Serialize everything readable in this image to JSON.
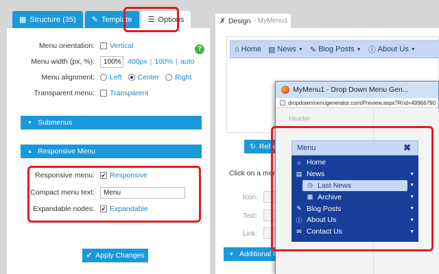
{
  "left_tabs": [
    {
      "label": "Structure (35)",
      "icon": "sitemap-icon"
    },
    {
      "label": "Template",
      "icon": "brush-icon"
    },
    {
      "label": "Options",
      "icon": "list-icon"
    }
  ],
  "options": {
    "orientation_label": "Menu orientation:",
    "orientation_value": "Vertical",
    "width_label": "Menu width (px, %):",
    "width_value": "100%",
    "width_presets": [
      "400px",
      "100%",
      "auto"
    ],
    "alignment_label": "Menu alignment:",
    "alignment_options": [
      "Left",
      "Center",
      "Right"
    ],
    "alignment_selected": "Center",
    "transparent_label": "Transparent menu:",
    "transparent_value": "Transparent",
    "help": "?"
  },
  "sections": {
    "submenus": "Submenus",
    "responsive": "Responsive Menu"
  },
  "responsive": {
    "responsive_label": "Responsive menu:",
    "responsive_value": "Responsive",
    "compact_label": "Compact menu text:",
    "compact_value": "Menu",
    "expandable_label": "Expandable nodes:",
    "expandable_value": "Expandable"
  },
  "apply_label": "Apply Changes",
  "design": {
    "title": "Design",
    "subtitle": "- MyMenu1",
    "menubar": [
      "Home",
      "News",
      "Blog Posts",
      "About Us"
    ],
    "refresh_label": "Refres",
    "click_message": "Click on a menu i",
    "props": [
      "Icon:",
      "Text:",
      "Link:"
    ],
    "additional_label": "Additional Op"
  },
  "popup": {
    "title": "MyMenu1 - Drop Down Menu Gen...",
    "url": "dropdownmenugenerator.com/Preview.aspx?Rnd=49966790",
    "header": "Header",
    "menu_title": "Menu",
    "close": "✖",
    "items": [
      {
        "label": "Home",
        "icon": "home-icon",
        "glyph": "⌂",
        "level": 0,
        "arrow": false,
        "highlight": false
      },
      {
        "label": "News",
        "icon": "newspaper-icon",
        "glyph": "▤",
        "level": 0,
        "arrow": true,
        "highlight": false
      },
      {
        "label": "Last News",
        "icon": "clock-icon",
        "glyph": "◷",
        "level": 1,
        "arrow": true,
        "highlight": true
      },
      {
        "label": "Archive",
        "icon": "calendar-icon",
        "glyph": "▦",
        "level": 1,
        "arrow": true,
        "highlight": false
      },
      {
        "label": "Blog Posts",
        "icon": "feather-icon",
        "glyph": "✎",
        "level": 0,
        "arrow": true,
        "highlight": false
      },
      {
        "label": "About Us",
        "icon": "info-icon",
        "glyph": "ⓘ",
        "level": 0,
        "arrow": true,
        "highlight": false
      },
      {
        "label": "Contact Us",
        "icon": "envelope-icon",
        "glyph": "✉",
        "level": 0,
        "arrow": true,
        "highlight": false
      }
    ]
  },
  "colors": {
    "accent": "#1b98d9",
    "highlight_red": "#e21b23",
    "menu_bg": "#173f9a",
    "menu_light": "#c6d8f4"
  }
}
